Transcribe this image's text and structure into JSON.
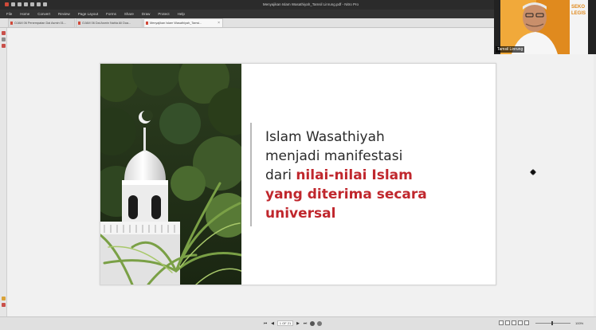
{
  "app": {
    "window_title": "Menyajikan Islam Wasathiyah_Tamsil Linrung.pdf - Nitro Pro"
  },
  "menu": [
    "File",
    "Home",
    "Convert",
    "Review",
    "Page Layout",
    "Forms",
    "Share",
    "Draw",
    "Protect",
    "Help"
  ],
  "tabs": [
    {
      "label": "OJAM 06 Penempatan Dai Asmin 01..."
    },
    {
      "label": "OJAM 06 Dai Asmin Nahla Ali Dua..."
    },
    {
      "label": "Menyajikan Islam Wasathiyah_Tamsi...",
      "active": true
    }
  ],
  "slide": {
    "line1": "Islam Wasathiyah",
    "line2": "menjadi manifestasi",
    "line3_plain": "dari ",
    "line3_highlight": "nilai-nilai Islam",
    "line4": "yang diterima secara",
    "line5": "universal"
  },
  "status": {
    "page_indicator": "1 OF 21",
    "zoom": "100%"
  },
  "video": {
    "participant_name": "Tamsil Linrung",
    "backdrop_text": "SEKO\nLEGIS"
  },
  "colors": {
    "highlight_red": "#c0272d",
    "titlebar": "#2b2b2b",
    "menubar": "#343434"
  }
}
